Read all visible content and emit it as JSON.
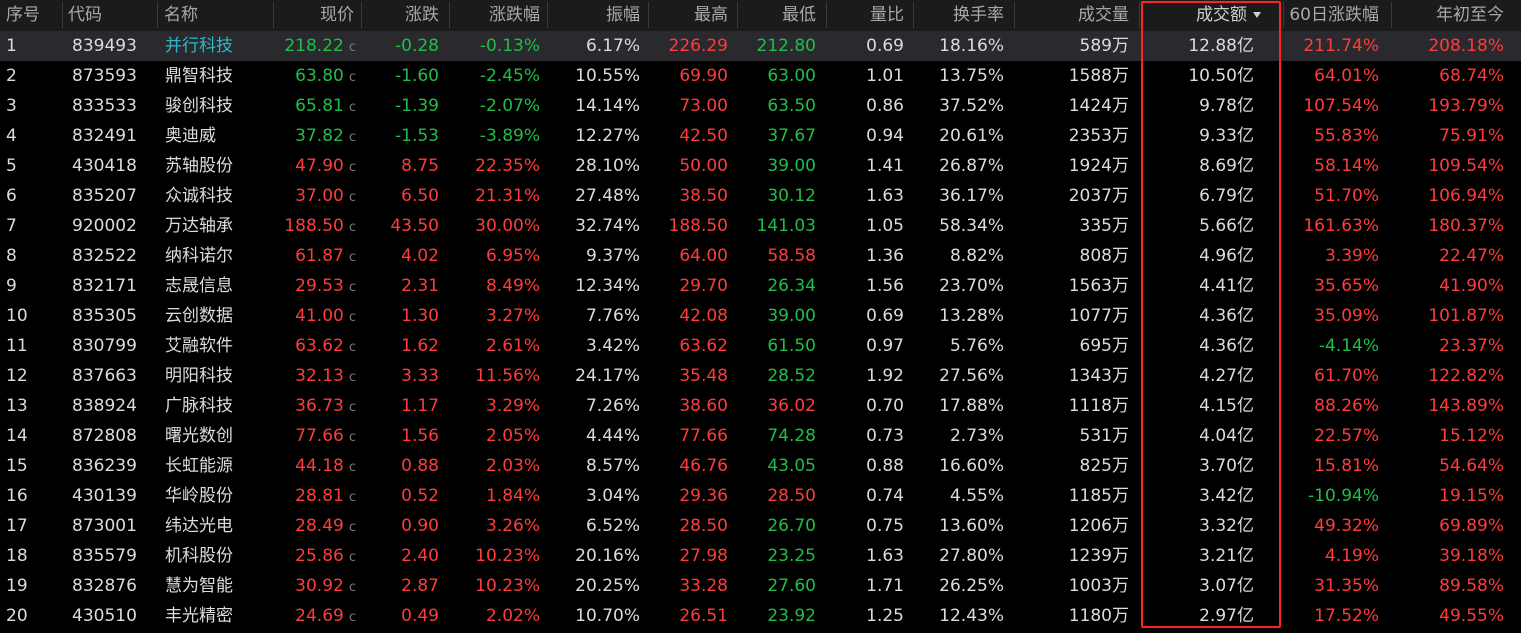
{
  "headers": {
    "idx": "序号",
    "code": "代码",
    "name": "名称",
    "price": "现价",
    "change": "涨跌",
    "pct": "涨跌幅",
    "amplitude": "振幅",
    "high": "最高",
    "low": "最低",
    "vol_ratio": "量比",
    "turnover": "换手率",
    "volume": "成交量",
    "amount": "成交额",
    "d60": "60日涨跌幅",
    "ytd": "年初至今"
  },
  "sorted_column": "amount",
  "price_suffix": "c",
  "colors": {
    "up": "#ff3b3b",
    "down": "#1dbf48",
    "highlight": "#ff2222",
    "selected_name": "#2bb9c8"
  },
  "rows": [
    {
      "idx": "1",
      "code": "839493",
      "name": "并行科技",
      "price": "218.22",
      "change": "-0.28",
      "pct": "-0.13%",
      "amplitude": "6.17%",
      "high": "226.29",
      "low": "212.80",
      "vol_ratio": "0.69",
      "turnover": "18.16%",
      "volume": "589万",
      "amount": "12.88亿",
      "d60": "211.74%",
      "ytd": "208.18%"
    },
    {
      "idx": "2",
      "code": "873593",
      "name": "鼎智科技",
      "price": "63.80",
      "change": "-1.60",
      "pct": "-2.45%",
      "amplitude": "10.55%",
      "high": "69.90",
      "low": "63.00",
      "vol_ratio": "1.01",
      "turnover": "13.75%",
      "volume": "1588万",
      "amount": "10.50亿",
      "d60": "64.01%",
      "ytd": "68.74%"
    },
    {
      "idx": "3",
      "code": "833533",
      "name": "骏创科技",
      "price": "65.81",
      "change": "-1.39",
      "pct": "-2.07%",
      "amplitude": "14.14%",
      "high": "73.00",
      "low": "63.50",
      "vol_ratio": "0.86",
      "turnover": "37.52%",
      "volume": "1424万",
      "amount": "9.78亿",
      "d60": "107.54%",
      "ytd": "193.79%"
    },
    {
      "idx": "4",
      "code": "832491",
      "name": "奥迪威",
      "price": "37.82",
      "change": "-1.53",
      "pct": "-3.89%",
      "amplitude": "12.27%",
      "high": "42.50",
      "low": "37.67",
      "vol_ratio": "0.94",
      "turnover": "20.61%",
      "volume": "2353万",
      "amount": "9.33亿",
      "d60": "55.83%",
      "ytd": "75.91%"
    },
    {
      "idx": "5",
      "code": "430418",
      "name": "苏轴股份",
      "price": "47.90",
      "change": "8.75",
      "pct": "22.35%",
      "amplitude": "28.10%",
      "high": "50.00",
      "low": "39.00",
      "vol_ratio": "1.41",
      "turnover": "26.87%",
      "volume": "1924万",
      "amount": "8.69亿",
      "d60": "58.14%",
      "ytd": "109.54%"
    },
    {
      "idx": "6",
      "code": "835207",
      "name": "众诚科技",
      "price": "37.00",
      "change": "6.50",
      "pct": "21.31%",
      "amplitude": "27.48%",
      "high": "38.50",
      "low": "30.12",
      "vol_ratio": "1.63",
      "turnover": "36.17%",
      "volume": "2037万",
      "amount": "6.79亿",
      "d60": "51.70%",
      "ytd": "106.94%"
    },
    {
      "idx": "7",
      "code": "920002",
      "name": "万达轴承",
      "price": "188.50",
      "change": "43.50",
      "pct": "30.00%",
      "amplitude": "32.74%",
      "high": "188.50",
      "low": "141.03",
      "vol_ratio": "1.05",
      "turnover": "58.34%",
      "volume": "335万",
      "amount": "5.66亿",
      "d60": "161.63%",
      "ytd": "180.37%"
    },
    {
      "idx": "8",
      "code": "832522",
      "name": "纳科诺尔",
      "price": "61.87",
      "change": "4.02",
      "pct": "6.95%",
      "amplitude": "9.37%",
      "high": "64.00",
      "low": "58.58",
      "vol_ratio": "1.36",
      "turnover": "8.82%",
      "volume": "808万",
      "amount": "4.96亿",
      "d60": "3.39%",
      "ytd": "22.47%"
    },
    {
      "idx": "9",
      "code": "832171",
      "name": "志晟信息",
      "price": "29.53",
      "change": "2.31",
      "pct": "8.49%",
      "amplitude": "12.34%",
      "high": "29.70",
      "low": "26.34",
      "vol_ratio": "1.56",
      "turnover": "23.70%",
      "volume": "1563万",
      "amount": "4.41亿",
      "d60": "35.65%",
      "ytd": "41.90%"
    },
    {
      "idx": "10",
      "code": "835305",
      "name": "云创数据",
      "price": "41.00",
      "change": "1.30",
      "pct": "3.27%",
      "amplitude": "7.76%",
      "high": "42.08",
      "low": "39.00",
      "vol_ratio": "0.69",
      "turnover": "13.28%",
      "volume": "1077万",
      "amount": "4.36亿",
      "d60": "35.09%",
      "ytd": "101.87%"
    },
    {
      "idx": "11",
      "code": "830799",
      "name": "艾融软件",
      "price": "63.62",
      "change": "1.62",
      "pct": "2.61%",
      "amplitude": "3.42%",
      "high": "63.62",
      "low": "61.50",
      "vol_ratio": "0.97",
      "turnover": "5.76%",
      "volume": "695万",
      "amount": "4.36亿",
      "d60": "-4.14%",
      "ytd": "23.37%"
    },
    {
      "idx": "12",
      "code": "837663",
      "name": "明阳科技",
      "price": "32.13",
      "change": "3.33",
      "pct": "11.56%",
      "amplitude": "24.17%",
      "high": "35.48",
      "low": "28.52",
      "vol_ratio": "1.92",
      "turnover": "27.56%",
      "volume": "1343万",
      "amount": "4.27亿",
      "d60": "61.70%",
      "ytd": "122.82%"
    },
    {
      "idx": "13",
      "code": "838924",
      "name": "广脉科技",
      "price": "36.73",
      "change": "1.17",
      "pct": "3.29%",
      "amplitude": "7.26%",
      "high": "38.60",
      "low": "36.02",
      "vol_ratio": "0.70",
      "turnover": "17.88%",
      "volume": "1118万",
      "amount": "4.15亿",
      "d60": "88.26%",
      "ytd": "143.89%"
    },
    {
      "idx": "14",
      "code": "872808",
      "name": "曙光数创",
      "price": "77.66",
      "change": "1.56",
      "pct": "2.05%",
      "amplitude": "4.44%",
      "high": "77.66",
      "low": "74.28",
      "vol_ratio": "0.73",
      "turnover": "2.73%",
      "volume": "531万",
      "amount": "4.04亿",
      "d60": "22.57%",
      "ytd": "15.12%"
    },
    {
      "idx": "15",
      "code": "836239",
      "name": "长虹能源",
      "price": "44.18",
      "change": "0.88",
      "pct": "2.03%",
      "amplitude": "8.57%",
      "high": "46.76",
      "low": "43.05",
      "vol_ratio": "0.88",
      "turnover": "16.60%",
      "volume": "825万",
      "amount": "3.70亿",
      "d60": "15.81%",
      "ytd": "54.64%"
    },
    {
      "idx": "16",
      "code": "430139",
      "name": "华岭股份",
      "price": "28.81",
      "change": "0.52",
      "pct": "1.84%",
      "amplitude": "3.04%",
      "high": "29.36",
      "low": "28.50",
      "vol_ratio": "0.74",
      "turnover": "4.55%",
      "volume": "1185万",
      "amount": "3.42亿",
      "d60": "-10.94%",
      "ytd": "19.15%"
    },
    {
      "idx": "17",
      "code": "873001",
      "name": "纬达光电",
      "price": "28.49",
      "change": "0.90",
      "pct": "3.26%",
      "amplitude": "6.52%",
      "high": "28.50",
      "low": "26.70",
      "vol_ratio": "0.75",
      "turnover": "13.60%",
      "volume": "1206万",
      "amount": "3.32亿",
      "d60": "49.32%",
      "ytd": "69.89%"
    },
    {
      "idx": "18",
      "code": "835579",
      "name": "机科股份",
      "price": "25.86",
      "change": "2.40",
      "pct": "10.23%",
      "amplitude": "20.16%",
      "high": "27.98",
      "low": "23.25",
      "vol_ratio": "1.63",
      "turnover": "27.80%",
      "volume": "1239万",
      "amount": "3.21亿",
      "d60": "4.19%",
      "ytd": "39.18%"
    },
    {
      "idx": "19",
      "code": "832876",
      "name": "慧为智能",
      "price": "30.92",
      "change": "2.87",
      "pct": "10.23%",
      "amplitude": "20.25%",
      "high": "33.28",
      "low": "27.60",
      "vol_ratio": "1.71",
      "turnover": "26.25%",
      "volume": "1003万",
      "amount": "3.07亿",
      "d60": "31.35%",
      "ytd": "89.58%"
    },
    {
      "idx": "20",
      "code": "430510",
      "name": "丰光精密",
      "price": "24.69",
      "change": "0.49",
      "pct": "2.02%",
      "amplitude": "10.70%",
      "high": "26.51",
      "low": "23.92",
      "vol_ratio": "1.25",
      "turnover": "12.43%",
      "volume": "1180万",
      "amount": "2.97亿",
      "d60": "17.52%",
      "ytd": "49.55%"
    }
  ]
}
